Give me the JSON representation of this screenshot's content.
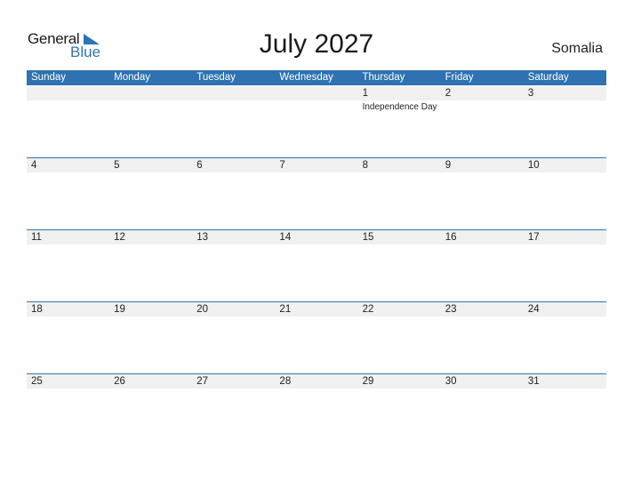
{
  "logo": {
    "general": "General",
    "blue": "Blue"
  },
  "title": "July 2027",
  "country": "Somalia",
  "colors": {
    "accent": "#2e72b2",
    "strip": "#f0f0f0"
  },
  "weekdays": [
    "Sunday",
    "Monday",
    "Tuesday",
    "Wednesday",
    "Thursday",
    "Friday",
    "Saturday"
  ],
  "weeks": [
    [
      {
        "d": ""
      },
      {
        "d": ""
      },
      {
        "d": ""
      },
      {
        "d": ""
      },
      {
        "d": "1",
        "holiday": "Independence Day"
      },
      {
        "d": "2"
      },
      {
        "d": "3"
      }
    ],
    [
      {
        "d": "4"
      },
      {
        "d": "5"
      },
      {
        "d": "6"
      },
      {
        "d": "7"
      },
      {
        "d": "8"
      },
      {
        "d": "9"
      },
      {
        "d": "10"
      }
    ],
    [
      {
        "d": "11"
      },
      {
        "d": "12"
      },
      {
        "d": "13"
      },
      {
        "d": "14"
      },
      {
        "d": "15"
      },
      {
        "d": "16"
      },
      {
        "d": "17"
      }
    ],
    [
      {
        "d": "18"
      },
      {
        "d": "19"
      },
      {
        "d": "20"
      },
      {
        "d": "21"
      },
      {
        "d": "22"
      },
      {
        "d": "23"
      },
      {
        "d": "24"
      }
    ],
    [
      {
        "d": "25"
      },
      {
        "d": "26"
      },
      {
        "d": "27"
      },
      {
        "d": "28"
      },
      {
        "d": "29"
      },
      {
        "d": "30"
      },
      {
        "d": "31"
      }
    ]
  ]
}
